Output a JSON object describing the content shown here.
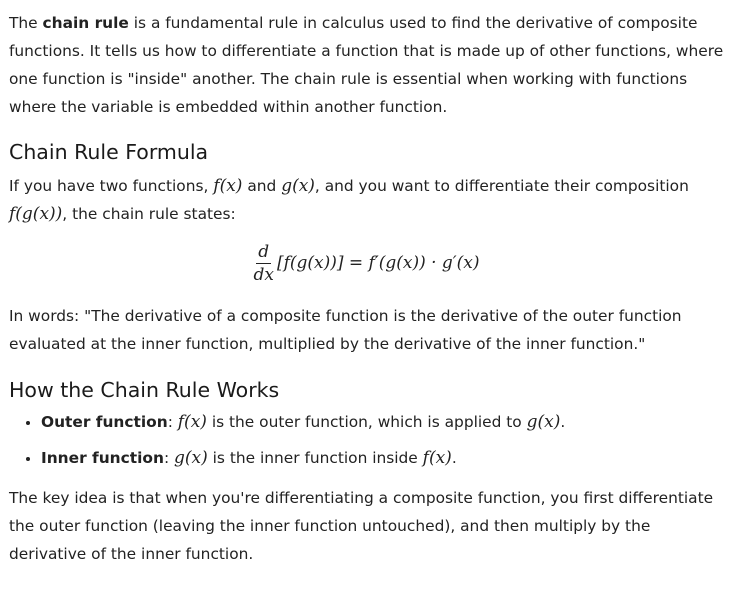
{
  "intro": {
    "part1": "The ",
    "bold_term": "chain rule",
    "part2": " is a fundamental rule in calculus used to find the derivative of composite functions. It tells us how to differentiate a function that is made up of other functions, where one function is \"inside\" another. The chain rule is essential when working with functions where the variable is embedded within another function."
  },
  "formula_section": {
    "heading": "Chain Rule Formula",
    "text1": "If you have two functions, ",
    "math1": "f(x)",
    "text2": " and ",
    "math2": "g(x)",
    "text3": ", and you want to differentiate their composition ",
    "math3": "f(g(x))",
    "text4": ", the chain rule states:",
    "display": {
      "numerator": "d",
      "denominator": "dx",
      "expression": "[f(g(x))] = f′(g(x)) · g′(x)"
    },
    "in_words": "In words: \"The derivative of a composite function is the derivative of the outer function evaluated at the inner function, multiplied by the derivative of the inner function.\""
  },
  "works_section": {
    "heading": "How the Chain Rule Works",
    "items": [
      {
        "label": "Outer function",
        "sep": ": ",
        "math_a": "f(x)",
        "text": " is the outer function, which is applied to ",
        "math_b": "g(x)",
        "end": "."
      },
      {
        "label": "Inner function",
        "sep": ": ",
        "math_a": "g(x)",
        "text": " is the inner function inside ",
        "math_b": "f(x)",
        "end": "."
      }
    ]
  },
  "closing": "The key idea is that when you're differentiating a composite function, you first differentiate the outer function (leaving the inner function untouched), and then multiply by the derivative of the inner function."
}
